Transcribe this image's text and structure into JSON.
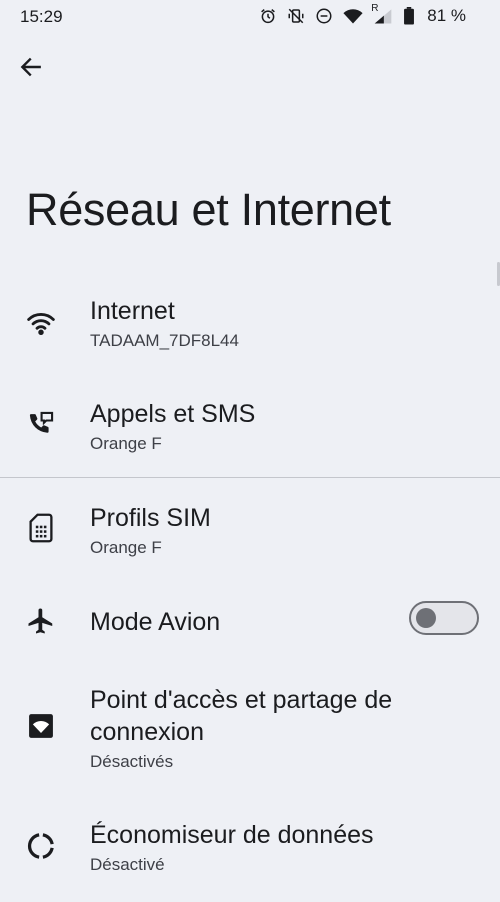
{
  "status_bar": {
    "time": "15:29",
    "battery_percent": "81 %",
    "network_indicator": "R",
    "icons": [
      "alarm-icon",
      "mute-vibrate-icon",
      "do-not-disturb-icon",
      "wifi-icon",
      "signal-icon",
      "battery-icon"
    ]
  },
  "header": {
    "back_icon": "arrow-back-icon",
    "title": "Réseau et Internet"
  },
  "items": [
    {
      "id": "internet",
      "icon": "wifi-icon",
      "title": "Internet",
      "subtitle": "TADAAM_7DF8L44"
    },
    {
      "id": "calls-sms",
      "icon": "call-sms-icon",
      "title": "Appels et SMS",
      "subtitle": "Orange F"
    },
    {
      "id": "sim-profiles",
      "icon": "sim-card-icon",
      "title": "Profils SIM",
      "subtitle": "Orange F"
    },
    {
      "id": "airplane-mode",
      "icon": "airplane-icon",
      "title": "Mode Avion",
      "toggle_on": false
    },
    {
      "id": "hotspot",
      "icon": "hotspot-icon",
      "title_line1": "Point d'accès et partage de",
      "title_line2": "connexion",
      "subtitle": "Désactivés"
    },
    {
      "id": "data-saver",
      "icon": "data-saver-icon",
      "title": "Économiseur de données",
      "subtitle": "Désactivé"
    }
  ],
  "colors": {
    "background": "#eef0f5",
    "text_primary": "#1b1c1f",
    "text_secondary": "#3e4047",
    "toggle_outline": "#6e7076"
  }
}
